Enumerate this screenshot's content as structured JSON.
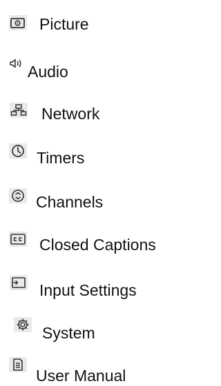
{
  "menu": {
    "items": [
      {
        "label": "Picture",
        "icon": "picture-icon"
      },
      {
        "label": "Audio",
        "icon": "audio-icon"
      },
      {
        "label": "Network",
        "icon": "network-icon"
      },
      {
        "label": "Timers",
        "icon": "clock-icon"
      },
      {
        "label": "Channels",
        "icon": "channels-icon"
      },
      {
        "label": "Closed Captions",
        "icon": "closed-captions-icon"
      },
      {
        "label": "Input Settings",
        "icon": "input-icon"
      },
      {
        "label": "System",
        "icon": "gear-icon"
      },
      {
        "label": "User Manual",
        "icon": "document-icon"
      }
    ]
  }
}
